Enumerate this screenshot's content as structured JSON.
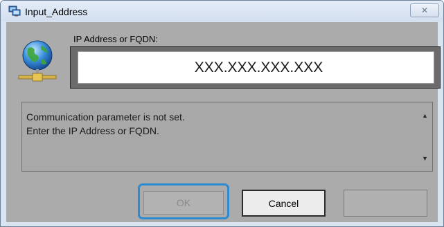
{
  "window": {
    "title": "Input_Address",
    "close_glyph": "✕"
  },
  "address": {
    "label": "IP Address or FQDN:",
    "value": "XXX.XXX.XXX.XXX"
  },
  "message": {
    "lines": [
      "Communication parameter is not set.",
      "Enter the IP Address or FQDN."
    ],
    "scroll_up_glyph": "▲",
    "scroll_down_glyph": "▼"
  },
  "buttons": {
    "ok_label": "OK",
    "cancel_label": "Cancel",
    "blank_label": ""
  },
  "icons": {
    "title_icon": "network-computer-icon",
    "main_icon": "globe-network-icon"
  },
  "colors": {
    "focus_ring": "#2f8bd1",
    "client_bg": "#ababab"
  }
}
